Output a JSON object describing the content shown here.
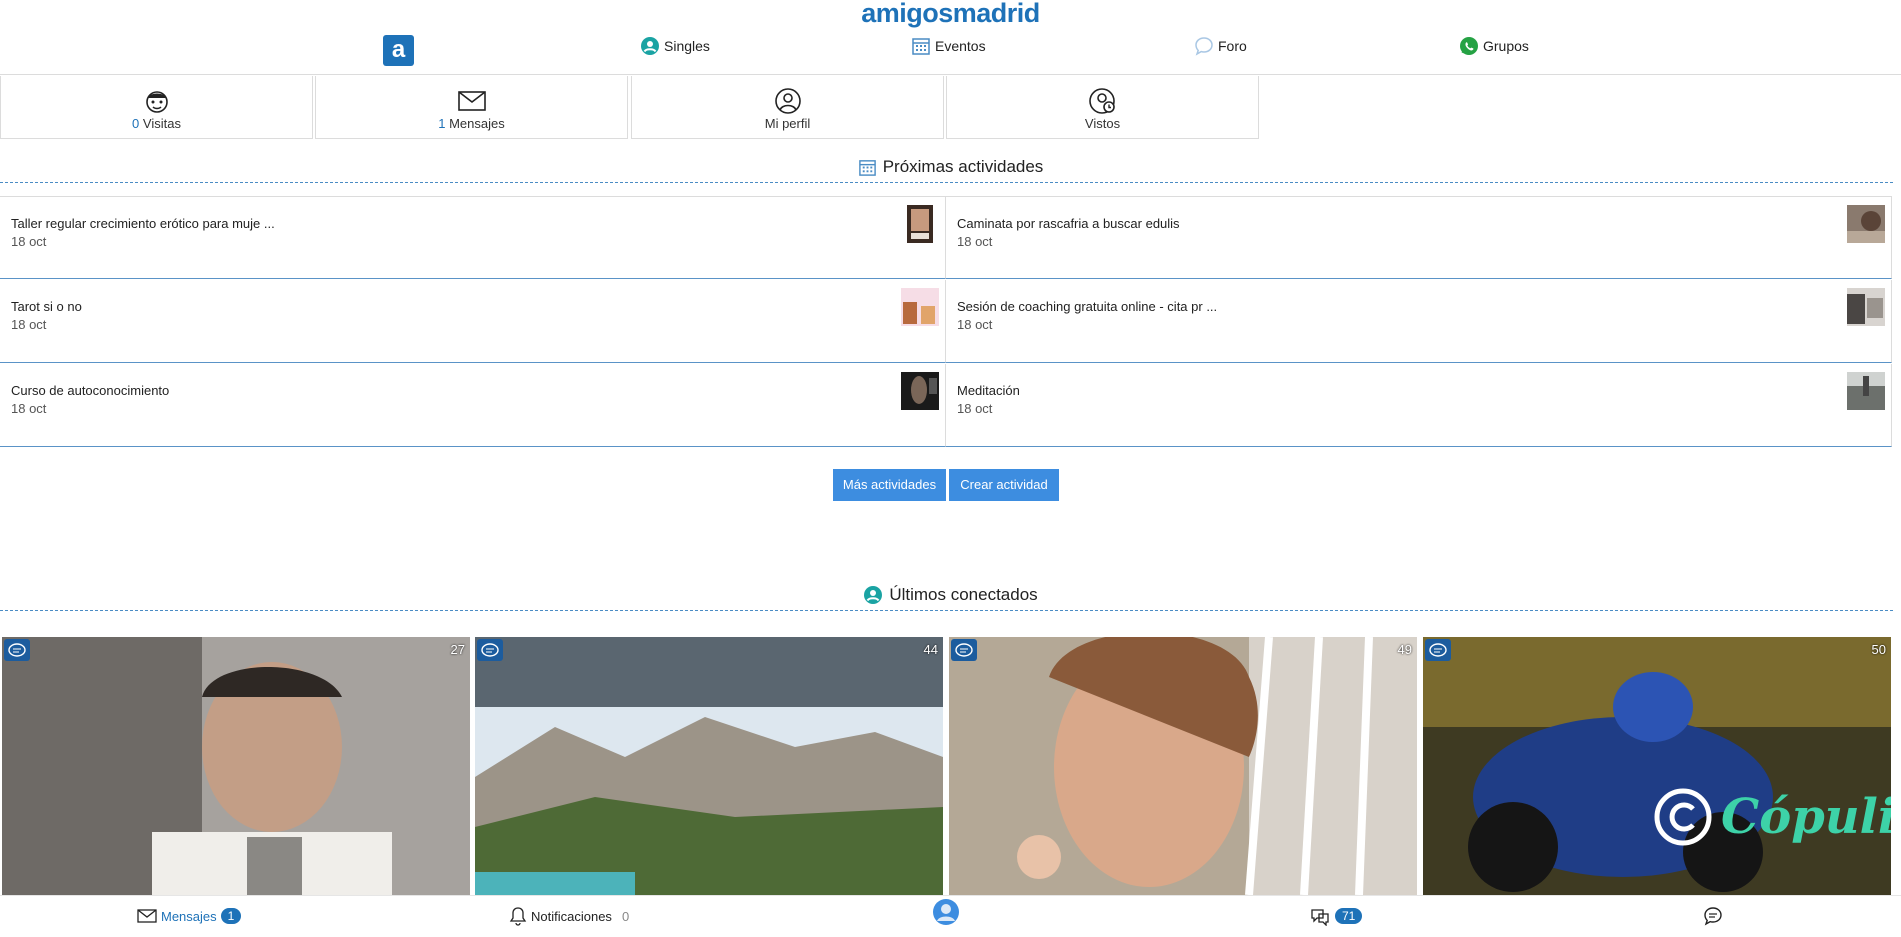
{
  "header": {
    "brand": "amigosmadrid",
    "logo_letter": "a",
    "nav": {
      "singles": "Singles",
      "eventos": "Eventos",
      "foro": "Foro",
      "grupos": "Grupos"
    }
  },
  "stats": {
    "visitas_count": "0",
    "visitas_label": " Visitas",
    "mensajes_count": "1",
    "mensajes_label": " Mensajes",
    "perfil_label": "Mi perfil",
    "vistos_label": "Vistos"
  },
  "activities": {
    "title": "Próximas actividades",
    "items": [
      {
        "title": "Taller regular crecimiento erótico para muje ...",
        "date": "18 oct"
      },
      {
        "title": "Caminata por rascafria a buscar edulis",
        "date": "18 oct"
      },
      {
        "title": "Tarot si o no",
        "date": "18 oct"
      },
      {
        "title": "Sesión de coaching gratuita online - cita pr ...",
        "date": "18 oct"
      },
      {
        "title": "Curso de autoconocimiento",
        "date": "18 oct"
      },
      {
        "title": "Meditación",
        "date": "18 oct"
      }
    ],
    "more_button": "Más actividades",
    "create_button": "Crear actividad"
  },
  "connected": {
    "title": "Últimos conectados",
    "cards": [
      {
        "age": "27"
      },
      {
        "age": "44"
      },
      {
        "age": "49"
      },
      {
        "age": "50"
      }
    ],
    "watermark": "Cópuli"
  },
  "bottombar": {
    "mensajes_label": "Mensajes",
    "mensajes_count": "1",
    "notificaciones_label": "Notificaciones",
    "notificaciones_count": "0",
    "chat_count": "71"
  },
  "colors": {
    "brand": "#1e72b8",
    "button": "#3d8de0",
    "divider": "#4a8cc4"
  }
}
